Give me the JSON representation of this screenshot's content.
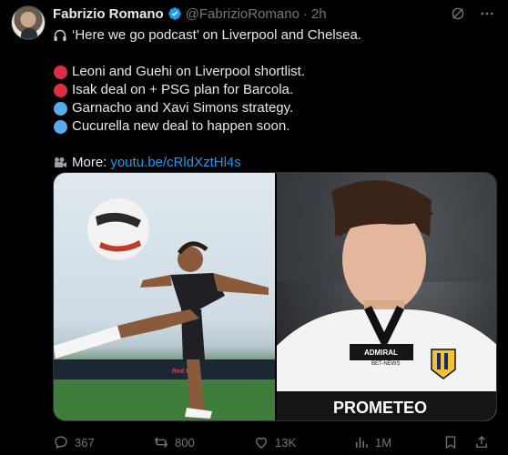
{
  "author": {
    "name": "Fabrizio Romano",
    "handle": "@FabrizioRomano",
    "separator": "·",
    "time": "2h"
  },
  "tweet": {
    "line1": "‘Here we go podcast’ on Liverpool and Chelsea.",
    "bullets": [
      {
        "color": "#dd2e44",
        "text": "Leoni and Guehi on Liverpool shortlist."
      },
      {
        "color": "#dd2e44",
        "text": "Isak deal on + PSG plan for Barcola."
      },
      {
        "color": "#55acee",
        "text": "Garnacho and Xavi Simons strategy."
      },
      {
        "color": "#55acee",
        "text": "Cucurella new deal to happen soon."
      }
    ],
    "more_label": "More:",
    "more_link": "youtu.be/cRldXztHl4s"
  },
  "media": {
    "left_sponsor": "Red Bull",
    "right_sponsor_top": "ADMIRAL",
    "right_sponsor_sub": "BET-NEWS",
    "right_shirt_text": "PROMETEO"
  },
  "stats": {
    "replies": "367",
    "reposts": "800",
    "likes": "13K",
    "views": "1M"
  },
  "colors": {
    "background": "#000000",
    "text": "#e7e9ea",
    "muted": "#71767b",
    "accent": "#1d9bf0"
  }
}
